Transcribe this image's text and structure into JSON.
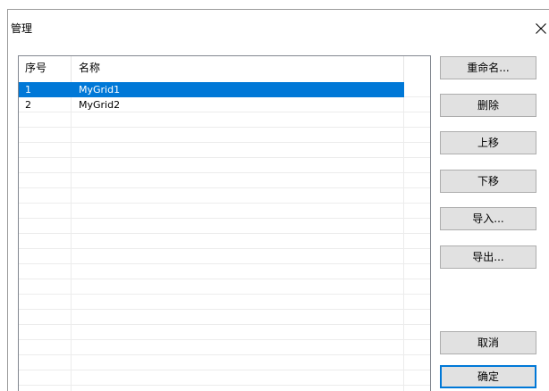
{
  "window": {
    "title": "管理",
    "close_icon": "close-icon"
  },
  "list": {
    "columns": {
      "index": "序号",
      "name": "名称"
    },
    "rows": [
      {
        "index": "1",
        "name": "MyGrid1",
        "selected": true
      },
      {
        "index": "2",
        "name": "MyGrid2",
        "selected": false
      }
    ]
  },
  "buttons": {
    "rename": {
      "label": "重命名..."
    },
    "delete": {
      "label": "删除"
    },
    "move_up": {
      "label": "上移"
    },
    "move_down": {
      "label": "下移"
    },
    "import": {
      "label": "导入..."
    },
    "export": {
      "label": "导出..."
    },
    "cancel": {
      "label": "取消"
    },
    "ok": {
      "label": "确定",
      "default": true
    }
  },
  "colors": {
    "selection": "#0078d7",
    "selection_text": "#ffffff",
    "default_button_border": "#0078d7"
  }
}
